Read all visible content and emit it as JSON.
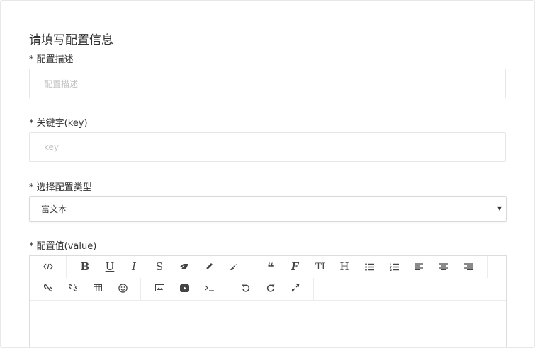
{
  "form": {
    "title": "请填写配置信息",
    "description": {
      "label": "* 配置描述",
      "placeholder": "配置描述"
    },
    "key": {
      "label": "* 关键字(key)",
      "placeholder": "key"
    },
    "type": {
      "label": "* 选择配置类型",
      "selected": "富文本"
    },
    "value": {
      "label": "* 配置值(value)"
    }
  },
  "toolbar": {
    "row1": [
      "code-view-icon",
      "bold-icon",
      "underline-icon",
      "italic-icon",
      "strikethrough-icon",
      "eraser-icon",
      "pencil-icon",
      "brush-icon",
      "blockquote-icon",
      "font-icon",
      "text-size-icon",
      "heading-icon",
      "bullet-list-icon",
      "numbered-list-icon",
      "align-left-icon",
      "align-center-icon",
      "align-right-icon"
    ],
    "row2": [
      "link-icon",
      "unlink-icon",
      "table-icon",
      "emoji-icon",
      "image-icon",
      "video-icon",
      "terminal-icon",
      "undo-icon",
      "redo-icon",
      "fullscreen-icon"
    ],
    "glyphs": {
      "bold": "B",
      "underline": "U",
      "italic": "I",
      "strike": "S",
      "heading": "H",
      "font": "F",
      "textsize": "TI"
    }
  }
}
